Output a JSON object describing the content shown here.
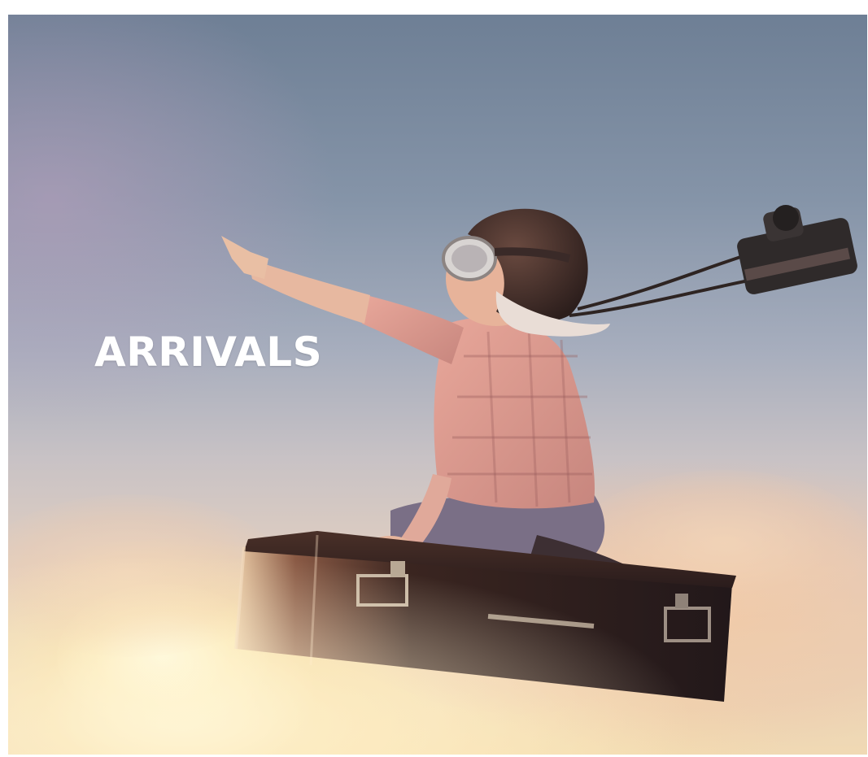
{
  "banner": {
    "title": "ARRIVALS"
  }
}
